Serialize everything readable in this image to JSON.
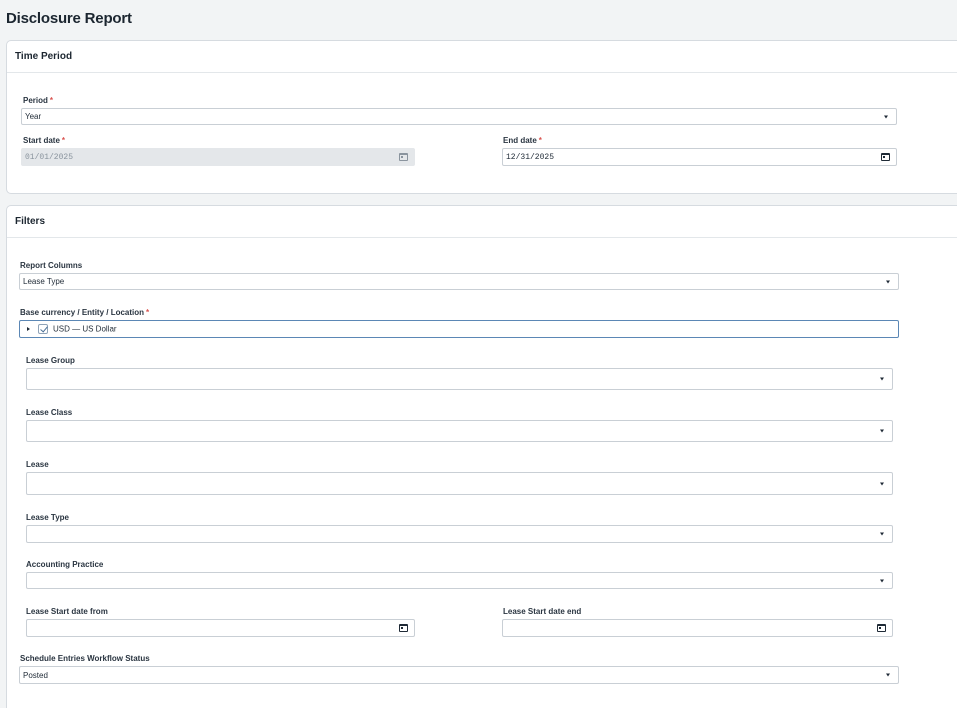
{
  "page": {
    "title": "Disclosure Report"
  },
  "time_period": {
    "header": "Time Period",
    "period": {
      "label": "Period",
      "required": "*",
      "value": "Year"
    },
    "start_date": {
      "label": "Start date",
      "required": "*",
      "value": "01/01/2025",
      "disabled": true
    },
    "end_date": {
      "label": "End date",
      "required": "*",
      "value": "12/31/2025"
    }
  },
  "filters": {
    "header": "Filters",
    "report_columns": {
      "label": "Report Columns",
      "value": "Lease Type"
    },
    "base_currency": {
      "label": "Base currency / Entity / Location",
      "required": "*",
      "tree_item": "USD — US Dollar",
      "checked": true
    },
    "lease_group": {
      "label": "Lease Group",
      "value": ""
    },
    "lease_class": {
      "label": "Lease Class",
      "value": ""
    },
    "lease": {
      "label": "Lease",
      "value": ""
    },
    "lease_type": {
      "label": "Lease Type",
      "value": ""
    },
    "accounting_practice": {
      "label": "Accounting Practice",
      "value": ""
    },
    "lease_start_from": {
      "label": "Lease Start date from",
      "value": ""
    },
    "lease_start_end": {
      "label": "Lease Start date end",
      "value": ""
    },
    "workflow_status": {
      "label": "Schedule Entries Workflow Status",
      "value": "Posted"
    }
  },
  "icons": {
    "dropdown": "chevron-down-icon",
    "calendar": "calendar-icon",
    "tree_expand": "caret-right-icon",
    "checkbox": "checkbox-checked-icon"
  },
  "colors": {
    "background": "#f2f4f5",
    "panel": "#ffffff",
    "required": "#d9534f",
    "disabled_field": "#e4e7ea",
    "focus_border": "#5b87b5"
  }
}
